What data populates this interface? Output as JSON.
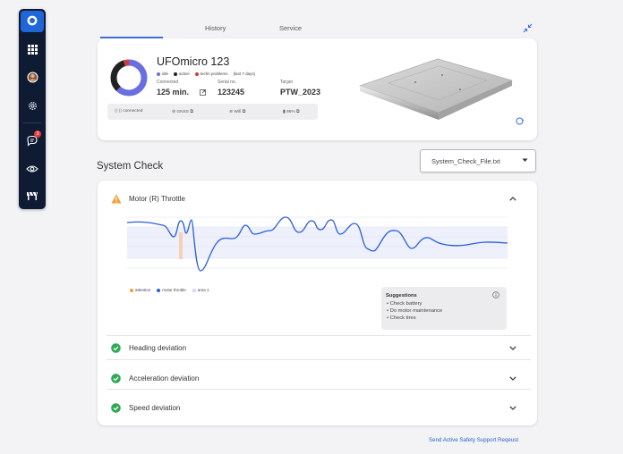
{
  "sidebar": {
    "badge_count": "3"
  },
  "tabs": [
    "History",
    "Service"
  ],
  "device": {
    "name": "UFOmicro 123",
    "legend": [
      {
        "label": "idle",
        "color": "#6a6fe0"
      },
      {
        "label": "active",
        "color": "#222222"
      },
      {
        "label": "techn problems",
        "color": "#d33a3a"
      },
      {
        "label": "(last 7 days)",
        "color": ""
      }
    ],
    "stats": [
      {
        "label": "Connected",
        "value": "125 min."
      },
      {
        "label": "Serial no.",
        "value": "123245"
      },
      {
        "label": "Target",
        "value": "PTW_2023"
      }
    ],
    "connectivity": [
      {
        "label": "connected"
      },
      {
        "label": "GNSS"
      },
      {
        "label": "Wifi"
      },
      {
        "label": "95%"
      }
    ],
    "usage": {
      "idle": 0.62,
      "active": 0.33,
      "techn_problems": 0.05
    }
  },
  "system_check": {
    "title": "System Check",
    "selected_file": "System_Check_File.txt",
    "items": [
      {
        "title": "Motor (R) Throttle",
        "status": "warning",
        "expanded": true
      },
      {
        "title": "Heading deviation",
        "status": "ok",
        "expanded": false
      },
      {
        "title": "Acceleration deviation",
        "status": "ok",
        "expanded": false
      },
      {
        "title": "Speed deviation",
        "status": "ok",
        "expanded": false
      }
    ],
    "chart_legend": [
      {
        "label": "attention",
        "color": "#f39c34"
      },
      {
        "label": "motor throttle",
        "color": "#2b5fd9"
      },
      {
        "label": "area 1",
        "color": "#d6d8f5"
      }
    ],
    "suggestions": {
      "title": "Suggestions",
      "items": [
        "Check battery",
        "Do motor maintenance",
        "Check tires"
      ]
    }
  },
  "footer": {
    "link": "Send Active Safety Support Reqeust"
  },
  "colors": {
    "accent": "#2b5fd9",
    "sidebar_bg": "#0e1b33",
    "ok": "#2eaa55",
    "warning": "#f39c34"
  }
}
